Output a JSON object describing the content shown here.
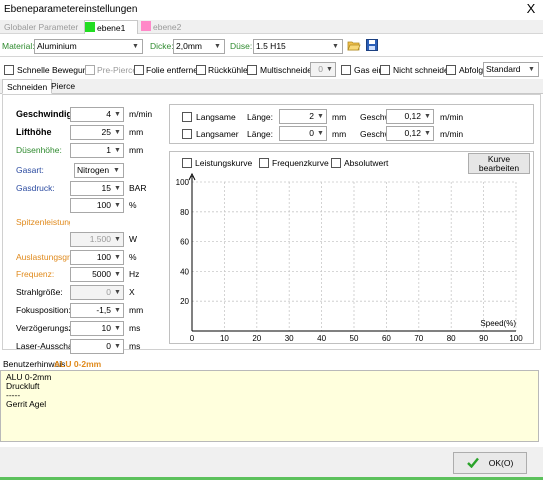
{
  "window": {
    "title": "Ebeneparametereinstellungen",
    "close": "X"
  },
  "top_tabs": [
    {
      "label": "Globaler Parameter",
      "color": ""
    },
    {
      "label": "ebene1",
      "color": "#22dd22"
    },
    {
      "label": "ebene2",
      "color": "#ff88c8"
    }
  ],
  "toolbar": {
    "material_label": "Material:",
    "material_value": "Aluminium",
    "dicke_label": "Dicke:",
    "dicke_value": "2,0mm",
    "duese_label": "Düse:",
    "duese_value": "1.5 H15"
  },
  "options": {
    "schnelle": "Schnelle Bewegung",
    "prepierce": "Pre-Pierce",
    "folie": "Folie entfernen",
    "rueckkuehler": "Rückkühler",
    "multischneider": "Multischneider",
    "multi_value": "0",
    "gas": "Gas ein",
    "nicht_schneiden": "Nicht schneiden",
    "abfolge": "Abfolge",
    "standard": "Standard"
  },
  "subtabs": [
    "Schneiden",
    "Pierce"
  ],
  "params": [
    {
      "label": "Geschwindigkeit",
      "value": "4",
      "unit": "m/min",
      "style": "bold"
    },
    {
      "label": "Lifthöhe",
      "value": "25",
      "unit": "mm",
      "style": "bold"
    },
    {
      "label": "Düsenhöhe:",
      "value": "1",
      "unit": "mm",
      "style": "green"
    },
    {
      "label": "Gasart:",
      "value": "Nitrogen",
      "unit": "",
      "style": "blue"
    },
    {
      "label": "Gasdruck:",
      "value": "15",
      "unit": "BAR",
      "style": "blue"
    },
    {
      "label": "",
      "value": "100",
      "unit": "%",
      "style": "plain"
    },
    {
      "label": "Spitzenleistung:",
      "value": "",
      "unit": "",
      "style": "orange"
    },
    {
      "label": "",
      "value": "1.500",
      "unit": "W",
      "style": "disabled"
    },
    {
      "label": "Auslastungsgrad",
      "value": "100",
      "unit": "%",
      "style": "orange"
    },
    {
      "label": "Frequenz:",
      "value": "5000",
      "unit": "Hz",
      "style": "orange"
    },
    {
      "label": "Strahlgröße:",
      "value": "0",
      "unit": "X",
      "style": "plain-disabled"
    },
    {
      "label": "Fokusposition:",
      "value": "-1,5",
      "unit": "mm",
      "style": "plain"
    },
    {
      "label": "Verzögerungszeit",
      "value": "10",
      "unit": "ms",
      "style": "plain"
    },
    {
      "label": "Laser-Ausschalt",
      "value": "0",
      "unit": "ms",
      "style": "plain"
    }
  ],
  "slow": {
    "row1_label": "Langsame",
    "row2_label": "Langsamer",
    "laenge_label": "Länge:",
    "laenge1": "2",
    "laenge2": "0",
    "mm": "mm",
    "gesch_label": "Geschw",
    "gesch1": "0,12",
    "gesch2": "0,12",
    "unit": "m/min"
  },
  "chart_opts": {
    "leistung": "Leistungskurve",
    "frequenz": "Frequenzkurve",
    "absolut": "Absolutwert",
    "edit_line1": "Kurve",
    "edit_line2": "bearbeiten"
  },
  "chart_data": {
    "type": "line",
    "xlabel": "Speed(%)",
    "ylabel": "",
    "xlim": [
      0,
      100
    ],
    "ylim": [
      0,
      100
    ],
    "xticks": [
      0,
      10,
      20,
      30,
      40,
      50,
      60,
      70,
      80,
      90,
      100
    ],
    "yticks": [
      20,
      40,
      60,
      80,
      100
    ],
    "grid": true,
    "series": []
  },
  "notes": {
    "label": "Benutzerhinweis",
    "label_overlay": "ALU 0-2mm",
    "lines": [
      "ALU 0-2mm",
      "Druckluft",
      "-----",
      "Gerrit Agel"
    ]
  },
  "ok_label": "OK(O)",
  "colors": {
    "accent_green": "#2e8a2e",
    "accent_orange": "#e08a1c",
    "accent_blue": "#2a4aa0"
  }
}
